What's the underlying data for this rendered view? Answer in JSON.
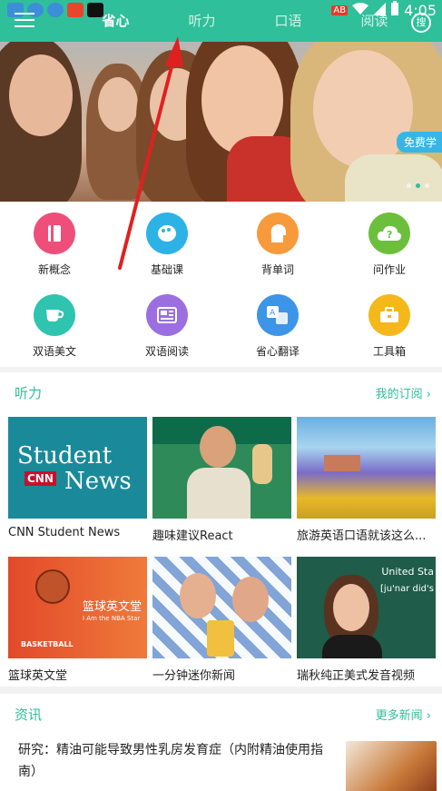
{
  "status_bar": {
    "time": "4:05",
    "badge": "AB"
  },
  "header": {
    "tabs": [
      {
        "label": "省心",
        "active": true
      },
      {
        "label": "听力",
        "active": false
      },
      {
        "label": "口语",
        "active": false
      },
      {
        "label": "阅读",
        "active": false
      }
    ],
    "search_label": "搜"
  },
  "banner": {
    "tag": "免费学"
  },
  "features": [
    {
      "label": "新概念",
      "icon": "book-icon",
      "color": "#ee4f7a"
    },
    {
      "label": "基础课",
      "icon": "palette-icon",
      "color": "#2db2e6"
    },
    {
      "label": "背单词",
      "icon": "head-icon",
      "color": "#f79a3b"
    },
    {
      "label": "问作业",
      "icon": "cloud-question-icon",
      "color": "#6cbf3c"
    },
    {
      "label": "双语美文",
      "icon": "cup-icon",
      "color": "#2fc4b0"
    },
    {
      "label": "双语阅读",
      "icon": "newspaper-icon",
      "color": "#9b6fe0"
    },
    {
      "label": "省心翻译",
      "icon": "translate-icon",
      "color": "#3d95e8"
    },
    {
      "label": "工具箱",
      "icon": "toolbox-icon",
      "color": "#f5b81b"
    }
  ],
  "listening": {
    "title": "听力",
    "more": "我的订阅",
    "items": [
      {
        "title": "CNN Student News",
        "thumb_text": "Student News",
        "thumb_brand": "CNN"
      },
      {
        "title": "趣味建议React"
      },
      {
        "title": "旅游英语口语就该这么..."
      },
      {
        "title": "篮球英文堂",
        "thumb_text": "篮球英文堂",
        "thumb_sub": "I Am the NBA Star",
        "thumb_tag": "BASKETBALL"
      },
      {
        "title": "一分钟迷你新闻"
      },
      {
        "title": "瑞秋纯正美式发音视频",
        "thumb_text": "United Sta",
        "thumb_sub": "[ju'nar did's"
      }
    ]
  },
  "news": {
    "title": "资讯",
    "more": "更多新闻",
    "items": [
      {
        "title": "研究：精油可能导致男性乳房发育症（内附精油使用指南）"
      }
    ]
  }
}
